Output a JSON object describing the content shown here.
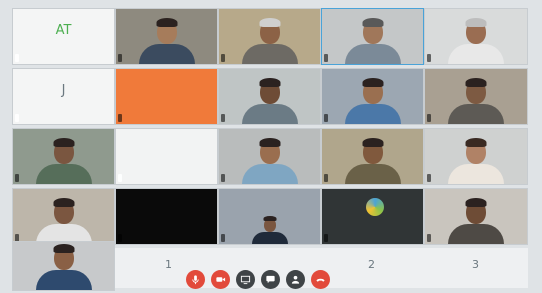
{
  "participants": [
    {
      "name": "AT",
      "initials": "AT"
    },
    {
      "name": ""
    },
    {
      "name": ""
    },
    {
      "name": ""
    },
    {
      "name": ""
    },
    {
      "name": ""
    },
    {
      "name": ""
    },
    {
      "name": ""
    },
    {
      "name": ""
    },
    {
      "name": ""
    },
    {
      "name": ""
    },
    {
      "name": ""
    },
    {
      "name": ""
    },
    {
      "name": ""
    },
    {
      "name": ""
    },
    {
      "name": ""
    },
    {
      "name": ""
    },
    {
      "name": ""
    },
    {
      "name": ""
    },
    {
      "name": ""
    },
    {
      "name": ""
    }
  ],
  "pages": [
    "1",
    "2",
    "3"
  ],
  "controls": [
    {
      "icon": "microphone-icon",
      "color": "#e24a3b"
    },
    {
      "icon": "video-camera-icon",
      "color": "#e24a3b"
    },
    {
      "icon": "screen-share-icon",
      "color": "#3f4447"
    },
    {
      "icon": "chat-icon",
      "color": "#3f4447"
    },
    {
      "icon": "participants-icon",
      "color": "#3f4447"
    },
    {
      "icon": "end-call-icon",
      "color": "#e24a3b"
    }
  ]
}
